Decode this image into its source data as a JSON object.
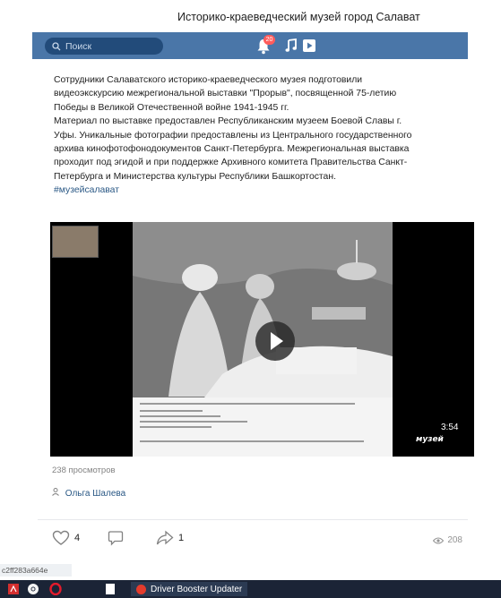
{
  "page": {
    "title": "Историко-краеведческий музей город Салават"
  },
  "topbar": {
    "search_placeholder": "Поиск",
    "notification_count": "20",
    "icons": [
      "search-icon",
      "bell-icon",
      "music-note-icon",
      "video-icon"
    ],
    "accent_color": "#4a76a8"
  },
  "post": {
    "text_lines": [
      "Сотрудники Салаватского историко-краеведческого музея подготовили",
      "видеоэкскурсию межрегиональной выставки \"Прорыв\", посвященной 75-летию",
      "Победы в Великой Отечественной войне 1941-1945 гг.",
      "Материал по выставке предоставлен Республиканским музеем Боевой Славы г.",
      "Уфы. Уникальные фотографии предоставлены из Центрального государственного",
      "архива кинофотофонодокументов Санкт-Петербурга. Межрегиональная выставка",
      "проходит под эгидой и при поддержке Архивного комитета Правительства Санкт-",
      "Петербурга и Министерства культуры Республики Башкортостан."
    ],
    "hashtag": "#музейсалават",
    "video": {
      "duration": "3:54",
      "watermark": "музей"
    },
    "views_text": "238 просмотров",
    "author": "Ольга Шалева",
    "likes": "4",
    "shares": "1",
    "views_count": "208"
  },
  "status_hash": "c2ff283a664e",
  "taskbar": {
    "app_label": "Driver Booster Updater"
  }
}
